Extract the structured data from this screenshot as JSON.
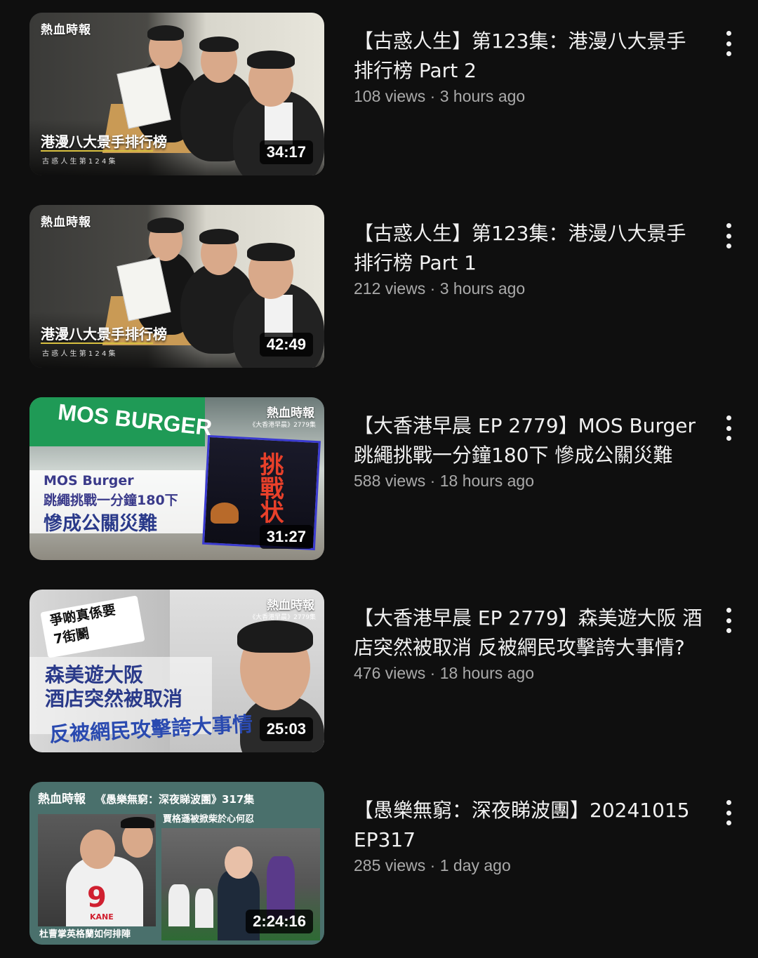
{
  "videos": [
    {
      "title": "【古惑人生】第123集：港漫八大景手排行榜 Part 2",
      "stats": "108 views · 3 hours ago",
      "duration": "34:17",
      "thumb": {
        "masthead": "熱血時報",
        "caption": "港漫八大景手排行榜",
        "subcaption": "古 惑 人 生 第 1 2 4 集"
      }
    },
    {
      "title": "【古惑人生】第123集：港漫八大景手排行榜 Part 1",
      "stats": "212 views · 3 hours ago",
      "duration": "42:49",
      "thumb": {
        "masthead": "熱血時報",
        "caption": "港漫八大景手排行榜",
        "subcaption": "古 惑 人 生 第 1 2 4 集"
      }
    },
    {
      "title": "【大香港早晨 EP 2779】MOS Burger跳繩挑戰一分鐘180下 慘成公關災難",
      "stats": "588 views · 18 hours ago",
      "duration": "31:27",
      "thumb": {
        "masthead": "熱血時報",
        "sub": "《大香港早晨》2779集",
        "brand": "MOS BURGER",
        "line1": "MOS Burger",
        "line2": "跳繩挑戰一分鐘180下",
        "line3": "慘成公關災難",
        "poster": "挑戰状"
      }
    },
    {
      "title": "【大香港早晨 EP 2779】森美遊大阪 酒店突然被取消 反被網民攻擊誇大事情?",
      "stats": "476 views · 18 hours ago",
      "duration": "25:03",
      "thumb": {
        "masthead": "熱血時報",
        "sub": "《大香港早晨》2779集",
        "sticker1": "爭啲真係要",
        "sticker2": "7街鬬",
        "line1": "森美遊大阪",
        "line2": "酒店突然被取消",
        "line3": "反被網民攻擊誇大事情"
      }
    },
    {
      "title": "【愚樂無窮：深夜睇波團】20241015 EP317",
      "stats": "285 views · 1 day ago",
      "duration": "2:24:16",
      "thumb": {
        "masthead": "熱血時報",
        "header": "《愚樂無窮：深夜睇波團》317集",
        "right_caption": "賈格遜被掀柴於心何忍",
        "left_caption": "杜曹掌英格蘭如何排陣",
        "jersey": "9",
        "jersey_name": "KANE"
      }
    }
  ]
}
